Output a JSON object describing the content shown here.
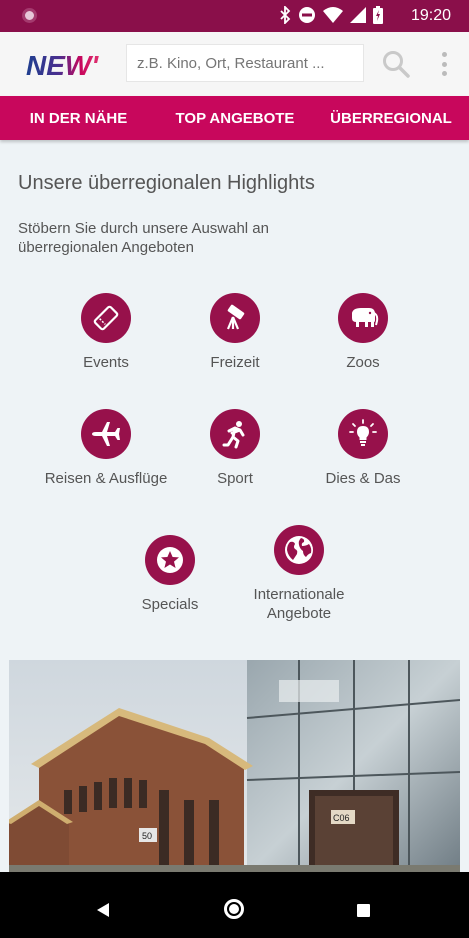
{
  "status_bar": {
    "time": "19:20",
    "icons": [
      "bluetooth-icon",
      "dnd-icon",
      "wifi-icon",
      "signal-icon",
      "battery-icon"
    ]
  },
  "header": {
    "logo_text": "NEW'",
    "search_placeholder": "z.B. Kino, Ort, Restaurant ...",
    "search_icon": "search-icon",
    "menu_icon": "more-vert-icon"
  },
  "tabs": [
    {
      "label": "IN DER NÄHE"
    },
    {
      "label": "TOP ANGEBOTE"
    },
    {
      "label": "ÜBERREGIONAL"
    }
  ],
  "main": {
    "title": "Unsere überregionalen Highlights",
    "subtitle": "Stöbern Sie durch unsere Auswahl an überregionalen Angeboten",
    "categories": [
      {
        "label": "Events",
        "icon": "ticket-icon"
      },
      {
        "label": "Freizeit",
        "icon": "telescope-icon"
      },
      {
        "label": "Zoos",
        "icon": "elephant-icon"
      },
      {
        "label": "Reisen & Ausflüge",
        "icon": "airplane-icon"
      },
      {
        "label": "Sport",
        "icon": "runner-icon"
      },
      {
        "label": "Dies & Das",
        "icon": "lightbulb-icon"
      },
      {
        "label": "Specials",
        "icon": "star-icon"
      },
      {
        "label": "Internationale Angebote",
        "icon": "globe-icon"
      }
    ]
  },
  "colors": {
    "status": "#8a0f4a",
    "tab_bar": "#c8075c",
    "icon_circle": "#97114b",
    "background": "#eef3f6"
  }
}
